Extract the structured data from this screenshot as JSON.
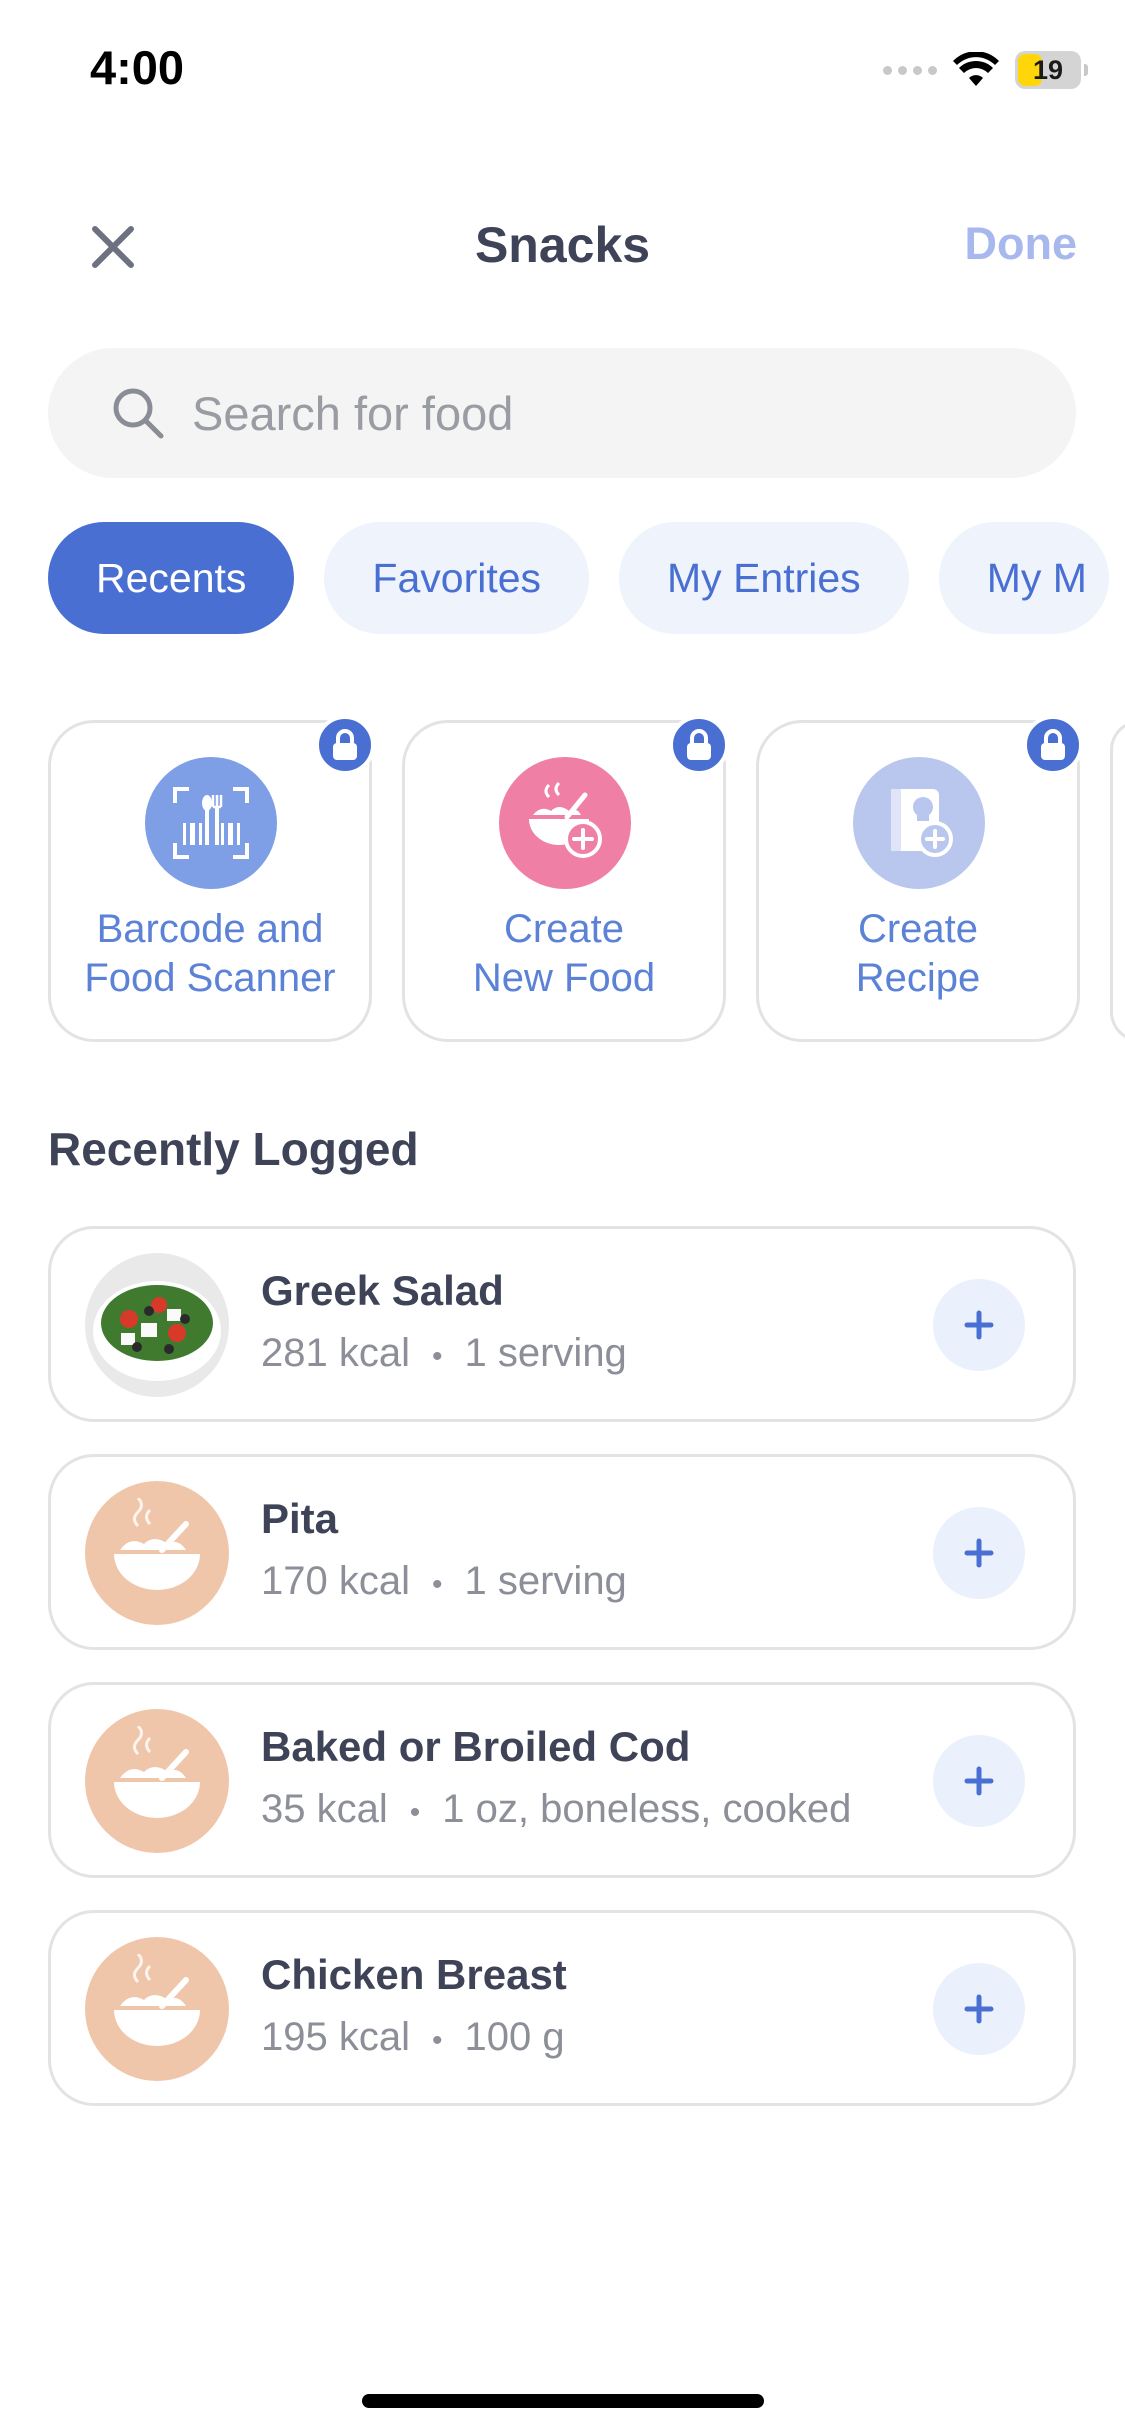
{
  "status_bar": {
    "time": "4:00",
    "battery": "19"
  },
  "header": {
    "title": "Snacks",
    "done_label": "Done"
  },
  "search": {
    "placeholder": "Search for food"
  },
  "tabs": [
    {
      "label": "Recents",
      "active": true
    },
    {
      "label": "Favorites",
      "active": false
    },
    {
      "label": "My Entries",
      "active": false
    },
    {
      "label": "My M",
      "active": false
    }
  ],
  "actions": [
    {
      "line1": "Barcode and",
      "line2": "Food Scanner",
      "icon": "barcode-scanner-icon",
      "locked": true
    },
    {
      "line1": "Create",
      "line2": "New Food",
      "icon": "create-food-icon",
      "locked": true
    },
    {
      "line1": "Create",
      "line2": "Recipe",
      "icon": "create-recipe-icon",
      "locked": true
    }
  ],
  "section_title": "Recently Logged",
  "foods": [
    {
      "name": "Greek Salad",
      "kcal": "281 kcal",
      "serving": "1 serving",
      "thumb": "greek-salad-photo"
    },
    {
      "name": "Pita",
      "kcal": "170 kcal",
      "serving": "1 serving",
      "thumb": "food-placeholder-icon"
    },
    {
      "name": "Baked or Broiled Cod",
      "kcal": "35 kcal",
      "serving": "1 oz, boneless, cooked",
      "thumb": "food-placeholder-icon"
    },
    {
      "name": "Chicken Breast",
      "kcal": "195 kcal",
      "serving": "100 g",
      "thumb": "food-placeholder-icon"
    }
  ],
  "colors": {
    "accent": "#4a6fd2",
    "tab_bg": "#eef3fc",
    "done": "#a6b8ee",
    "card_border": "#e3e3e6",
    "placeholder_thumb": "#f0c6ab"
  }
}
